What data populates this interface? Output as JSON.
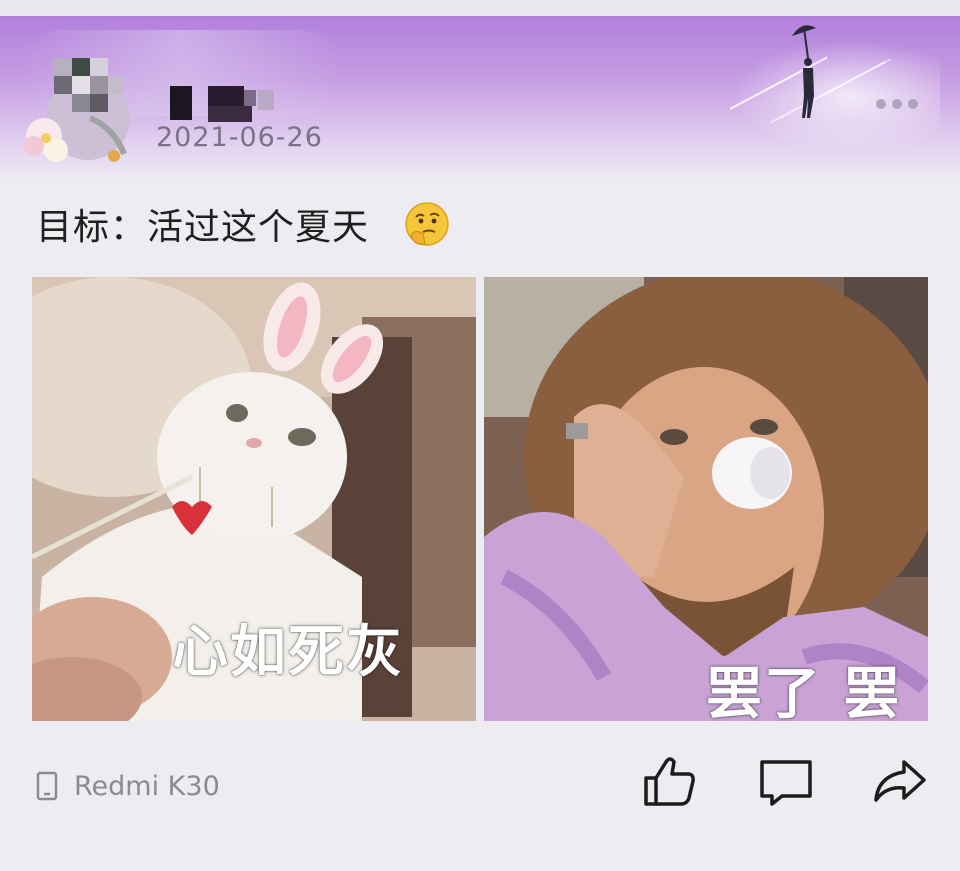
{
  "post": {
    "author_avatar": "avatar",
    "author_name": "",
    "date": "2021-06-26",
    "text": "目标：活过这个夏天",
    "text_emoji": "thinking-face-emoji",
    "menu_icon": "more-dots-icon"
  },
  "images": [
    {
      "caption": "心如死灰",
      "subject": "white cat with bunny ears"
    },
    {
      "caption": "罢了 罢了",
      "subject": "man drinking from tiny cup"
    }
  ],
  "footer": {
    "device_icon": "phone-icon",
    "device": "Redmi K30",
    "actions": [
      "like-icon",
      "comment-icon",
      "share-icon"
    ]
  },
  "colors": {
    "header_top": "#b27fdc",
    "background": "#edecf1",
    "text": "#1f1f1f",
    "muted": "#8b8992"
  }
}
